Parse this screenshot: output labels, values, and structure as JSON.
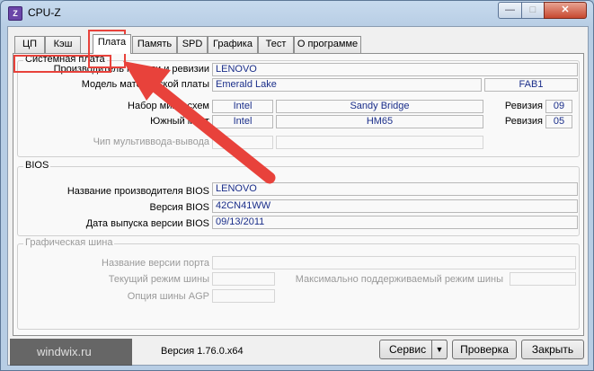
{
  "window": {
    "title": "CPU-Z",
    "app_icon": "cpu-z-icon"
  },
  "caption_buttons": {
    "minimize": "—",
    "maximize": "□",
    "close": "✕"
  },
  "tabs": [
    "ЦП",
    "Кэш",
    "Плата",
    "Память",
    "SPD",
    "Графика",
    "Тест",
    "О программе"
  ],
  "active_tab": "Плата",
  "motherboard": {
    "group_title": "Системная плата",
    "manufacturer_label": "Производитель модели и ревизии",
    "manufacturer_value": "LENOVO",
    "model_label": "Модель материнской платы",
    "model_value": "Emerald Lake",
    "model_rev": "FAB1",
    "chipset_label": "Набор микросхем",
    "chipset_vendor": "Intel",
    "chipset_name": "Sandy Bridge",
    "chipset_rev_label": "Ревизия",
    "chipset_rev": "09",
    "southbridge_label": "Южный мост",
    "southbridge_vendor": "Intel",
    "southbridge_name": "HM65",
    "southbridge_rev_label": "Ревизия",
    "southbridge_rev": "05",
    "lpcio_label": "Чип мультиввода-вывода"
  },
  "bios": {
    "group_title": "BIOS",
    "vendor_label": "Название производителя BIOS",
    "vendor_value": "LENOVO",
    "version_label": "Версия BIOS",
    "version_value": "42CN41WW",
    "date_label": "Дата выпуска версии BIOS",
    "date_value": "09/13/2011"
  },
  "graphic_bus": {
    "group_title": "Графическая шина",
    "version_label": "Название версии порта",
    "current_label": "Текущий режим шины",
    "max_label": "Максимально поддерживаемый режим шины",
    "agp_label": "Опция шины AGP"
  },
  "footer": {
    "watermark": "windwix.ru",
    "version": "Версия 1.76.0.x64",
    "service_button": "Сервис",
    "validate_button": "Проверка",
    "close_button": "Закрыть"
  },
  "annotation_color": "#e8423b"
}
